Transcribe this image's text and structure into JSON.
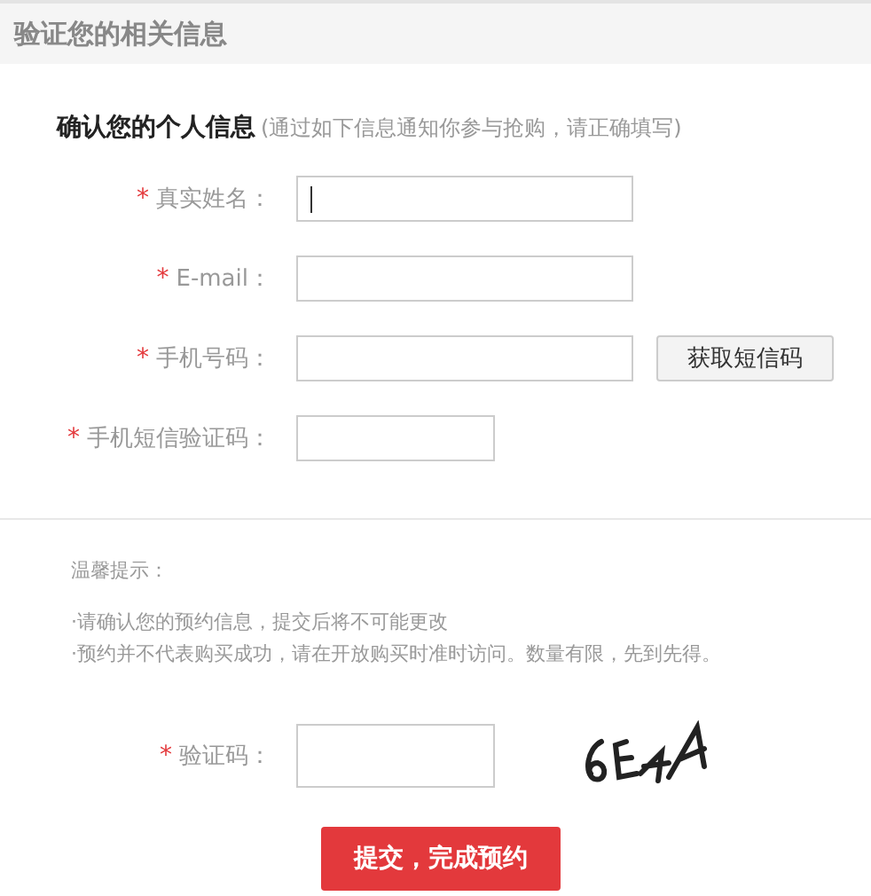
{
  "header": {
    "title": "验证您的相关信息"
  },
  "section": {
    "title": "确认您的个人信息",
    "hint": "(通过如下信息通知你参与抢购，请正确填写)"
  },
  "fields": [
    {
      "label": "真实姓名：",
      "kind": "wide",
      "focused": true
    },
    {
      "label": "E-mail：",
      "kind": "wide",
      "focused": false
    },
    {
      "label": "手机号码：",
      "kind": "wide",
      "focused": false,
      "button": "获取短信码"
    },
    {
      "label": "手机短信验证码：",
      "kind": "narrow",
      "focused": false
    }
  ],
  "required_mark": "*",
  "tips": {
    "title": "温馨提示：",
    "lines": [
      "·请确认您的预约信息，提交后将不可能更改",
      "·预约并不代表购买成功，请在开放购买时准时访问。数量有限，先到先得。"
    ]
  },
  "captcha": {
    "label": "验证码："
  },
  "submit": "提交，完成预约"
}
